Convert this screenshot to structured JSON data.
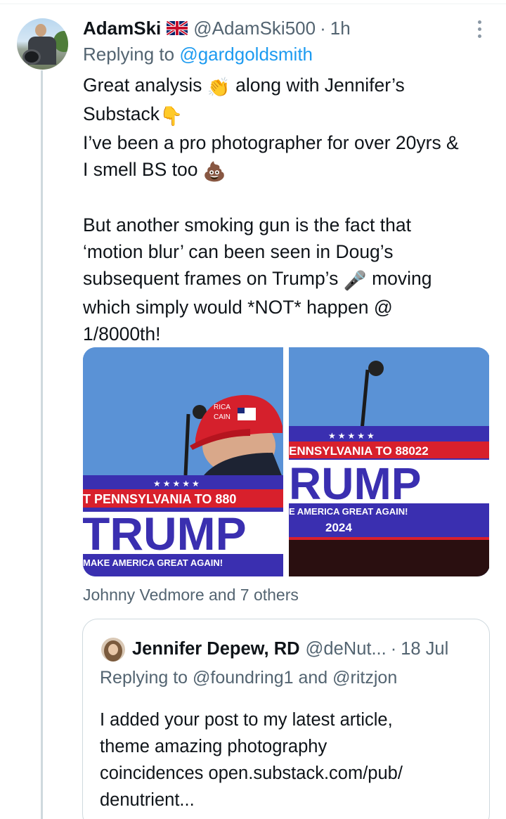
{
  "tweet": {
    "author_name": "AdamSki",
    "flag_icon": "uk-flag-icon",
    "handle": "@AdamSki500",
    "separator": "·",
    "time": "1h",
    "replying_prefix": "Replying to ",
    "replying_to": "@gardgoldsmith",
    "lines": [
      {
        "text": "Great analysis ",
        "emoji": "👏",
        "after": " along with Jennifer’s"
      },
      {
        "text": "Substack",
        "emoji": "👇",
        "after": ""
      },
      {
        "text": "I’ve been a pro photographer for over 20yrs &",
        "emoji": "",
        "after": ""
      },
      {
        "text": "I smell BS too ",
        "emoji": "💩",
        "after": ""
      },
      {
        "text": "But another smoking gun is the fact that",
        "emoji": "",
        "after": ""
      },
      {
        "text": "‘motion blur’ can been seen in Doug’s",
        "emoji": "",
        "after": ""
      },
      {
        "text": "subsequent frames on Trump’s ",
        "emoji": "🎤",
        "after": " moving"
      },
      {
        "text": "which simply would *NOT* happen @",
        "emoji": "",
        "after": ""
      },
      {
        "text": "1/8000th!",
        "emoji": "",
        "after": ""
      }
    ],
    "liked_by": "Johnny Vedmore and 7 others"
  },
  "photos": {
    "left": {
      "cap_text_1": "RICA",
      "cap_text_2": "CAIN",
      "banner_stars": "★★★★★",
      "banner_line": "T PENNSYLVANIA TO 880",
      "banner_big": "TRUMP",
      "banner_slogan": "MAKE AMERICA GREAT AGAIN!"
    },
    "right": {
      "banner_stars": "★★★★★",
      "banner_line": "ENNSYLVANIA TO 88022",
      "banner_big": "RUMP",
      "banner_slogan": "E AMERICA GREAT AGAIN!",
      "banner_year": "2024"
    }
  },
  "quote": {
    "author_name": "Jennifer Depew, RD",
    "handle": "@deNut...",
    "separator": "·",
    "date": "18 Jul",
    "replying_text": "Replying to @foundring1 and @ritzjon",
    "body_lines": [
      "I added your post to my latest article,",
      "theme amazing photography",
      "coincidences open.substack.com/pub/",
      "denutrient..."
    ]
  },
  "colors": {
    "link": "#1d9bf0",
    "muted": "#536471",
    "banner_blue": "#3a2fb0",
    "banner_red": "#d8202c",
    "sky": "#5a92d6"
  }
}
